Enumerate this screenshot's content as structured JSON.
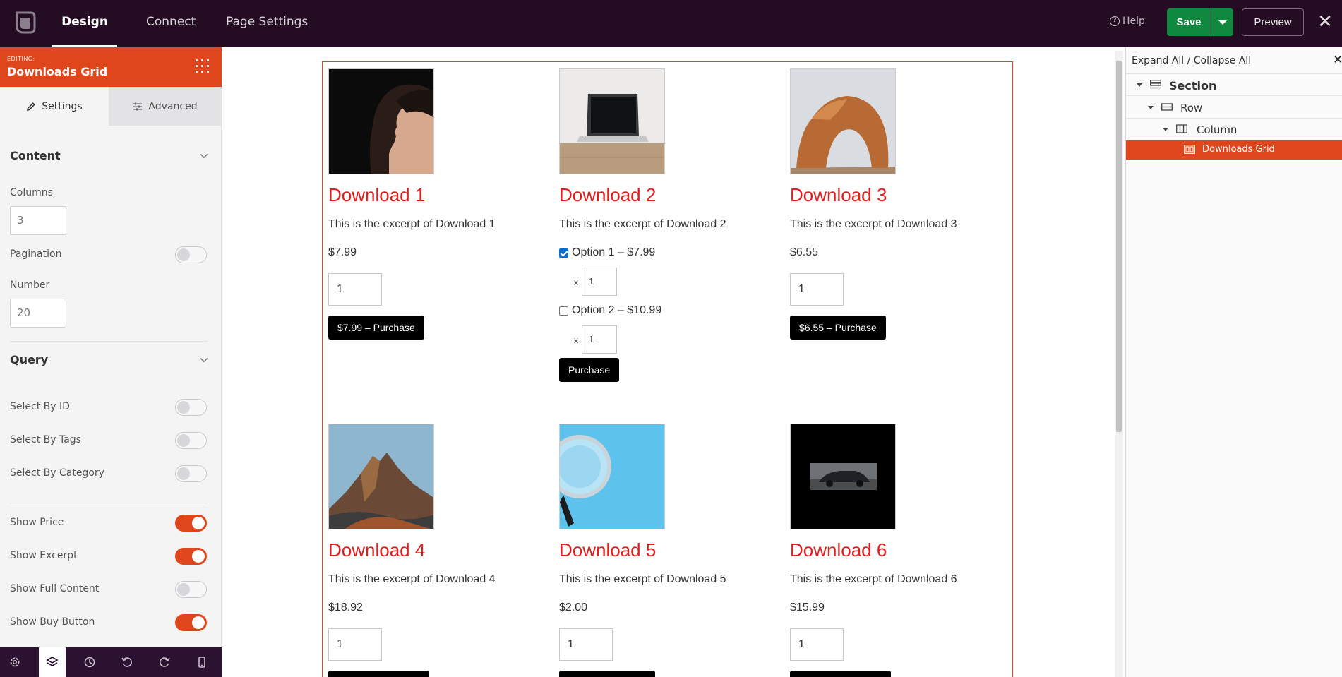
{
  "topbar": {
    "tabs": [
      {
        "label": "Design",
        "active": true
      },
      {
        "label": "Connect",
        "active": false
      },
      {
        "label": "Page Settings",
        "active": false
      }
    ],
    "help_label": "Help",
    "save_label": "Save",
    "preview_label": "Preview"
  },
  "panel": {
    "editing_label": "EDITING:",
    "module_title": "Downloads Grid",
    "tabs": {
      "settings": "Settings",
      "advanced": "Advanced"
    },
    "content_section": "Content",
    "columns_label": "Columns",
    "columns_value": "3",
    "pagination_label": "Pagination",
    "pagination_on": false,
    "number_label": "Number",
    "number_value": "20",
    "query_section": "Query",
    "toggles": [
      {
        "label": "Select By ID",
        "on": false
      },
      {
        "label": "Select By Tags",
        "on": false
      },
      {
        "label": "Select By Category",
        "on": false
      },
      {
        "label": "Show Price",
        "on": true
      },
      {
        "label": "Show Excerpt",
        "on": true
      },
      {
        "label": "Show Full Content",
        "on": false
      },
      {
        "label": "Show Buy Button",
        "on": true
      }
    ]
  },
  "downloads": [
    {
      "title": "Download 1",
      "excerpt": "This is the excerpt of Download 1",
      "price": "$7.99",
      "qty": "1",
      "button": "$7.99 – Purchase"
    },
    {
      "title": "Download 2",
      "excerpt": "This is the excerpt of Download 2",
      "options": [
        {
          "label": "Option 1 – $7.99",
          "checked": true,
          "x": "x",
          "qty": "1"
        },
        {
          "label": "Option 2 – $10.99",
          "checked": false,
          "x": "x",
          "qty": "1"
        }
      ],
      "button": "Purchase"
    },
    {
      "title": "Download 3",
      "excerpt": "This is the excerpt of Download 3",
      "price": "$6.55",
      "qty": "1",
      "button": "$6.55 – Purchase"
    },
    {
      "title": "Download 4",
      "excerpt": "This is the excerpt of Download 4",
      "price": "$18.92",
      "qty": "1"
    },
    {
      "title": "Download 5",
      "excerpt": "This is the excerpt of Download 5",
      "price": "$2.00",
      "qty": "1"
    },
    {
      "title": "Download 6",
      "excerpt": "This is the excerpt of Download 6",
      "price": "$15.99",
      "qty": "1"
    }
  ],
  "outline": {
    "header": "Expand All / Collapse All",
    "nodes": [
      {
        "label": "Section",
        "icon": "section-icon"
      },
      {
        "label": "Row",
        "icon": "row-icon"
      },
      {
        "label": "Column",
        "icon": "column-icon"
      },
      {
        "label": "Downloads Grid",
        "icon": "module-icon",
        "selected": true
      }
    ]
  },
  "colors": {
    "accent": "#e0461c",
    "topbar": "#240d23",
    "save": "#10883e",
    "download_title": "#e41d1d"
  }
}
